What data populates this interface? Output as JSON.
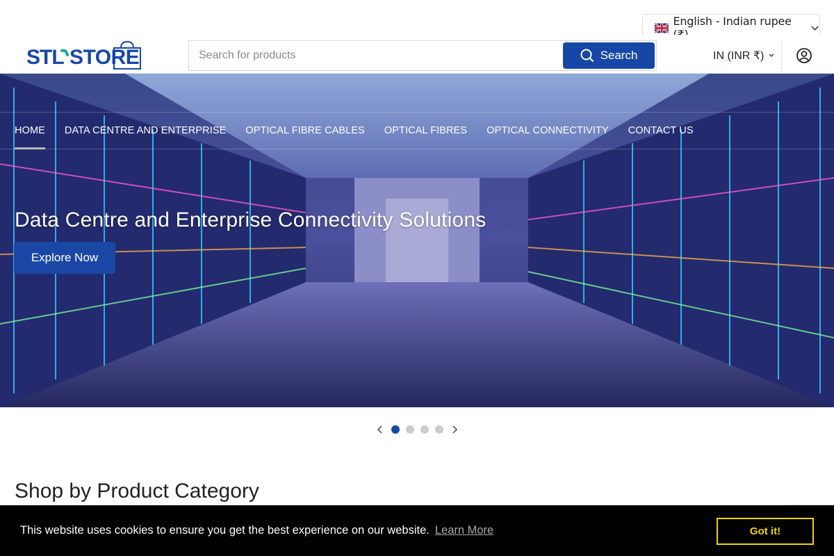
{
  "header": {
    "language_selector": "English - Indian rupee (₹)",
    "logo_alt": "STL STORE",
    "search": {
      "placeholder": "Search for products",
      "button_label": "Search"
    },
    "currency": "IN (INR ₹)"
  },
  "nav": {
    "items": [
      {
        "label": "HOME",
        "active": true
      },
      {
        "label": "DATA CENTRE AND ENTERPRISE"
      },
      {
        "label": "OPTICAL FIBRE CABLES"
      },
      {
        "label": "OPTICAL FIBRES"
      },
      {
        "label": "OPTICAL CONNECTIVITY"
      },
      {
        "label": "CONTACT US"
      }
    ]
  },
  "hero": {
    "title": "Data Centre and Enterprise Connectivity Solutions",
    "button_label": "Explore Now"
  },
  "carousel": {
    "slide_count": 4,
    "active_index": 0
  },
  "sections": {
    "shop_by_category": "Shop by Product Category"
  },
  "cookie_bar": {
    "message": "This website uses cookies to ensure you get the best experience on our website.",
    "learn_more": "Learn More",
    "accept": "Got it!"
  },
  "colors": {
    "brand_blue": "#1747a6",
    "cookie_accent": "#f1d600"
  }
}
